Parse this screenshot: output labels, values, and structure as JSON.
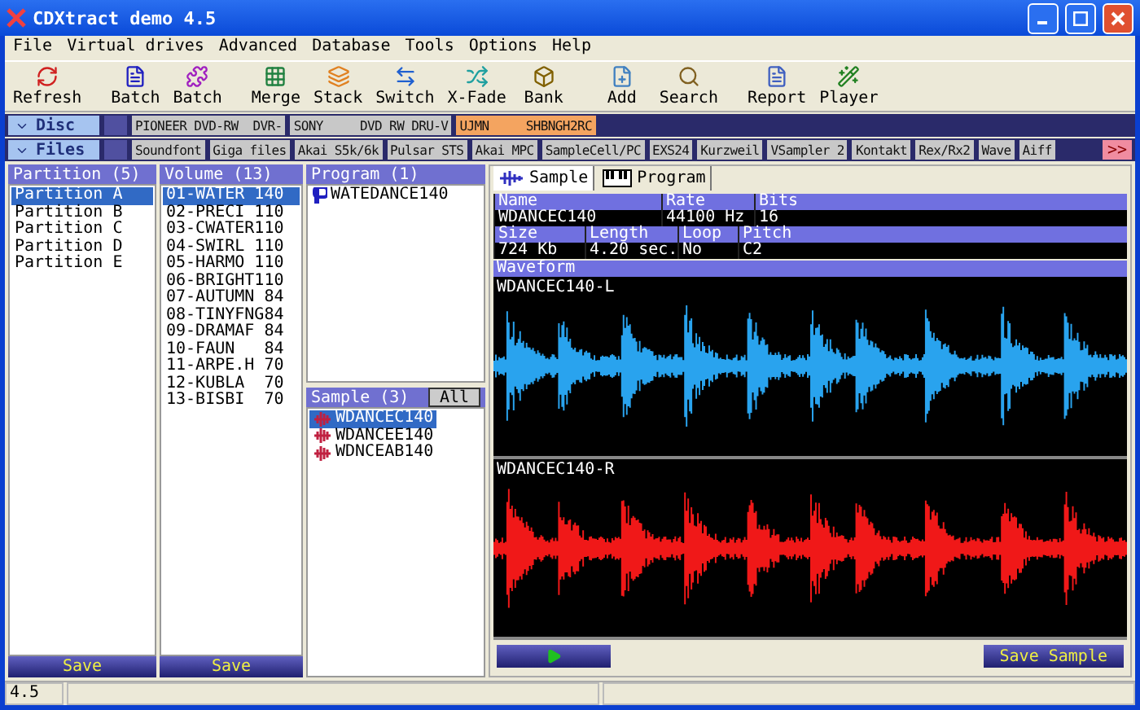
{
  "window": {
    "title": "CDXtract demo 4.5"
  },
  "menu": [
    "File",
    "Virtual drives",
    "Advanced",
    "Database",
    "Tools",
    "Options",
    "Help"
  ],
  "toolbar": [
    {
      "label": "Refresh"
    },
    {
      "label": "Batch"
    },
    {
      "label": "Batch"
    },
    {
      "label": "Merge"
    },
    {
      "label": "Stack"
    },
    {
      "label": "Switch"
    },
    {
      "label": "X-Fade"
    },
    {
      "label": "Bank"
    },
    {
      "label": "Add"
    },
    {
      "label": "Search"
    },
    {
      "label": "Report"
    },
    {
      "label": "Player"
    }
  ],
  "disc_bar": {
    "label": "Disc",
    "drives": [
      {
        "label": "PIONEER DVD-RW  DVR-",
        "selected": false
      },
      {
        "label": "SONY     DVD RW DRU-V",
        "selected": false
      },
      {
        "label": "UJMN     SHBNGH2RC",
        "selected": true
      }
    ]
  },
  "files_bar": {
    "label": "Files",
    "formats": [
      "Soundfont",
      "Giga files",
      "Akai S5k/6k",
      "Pulsar STS",
      "Akai MPC",
      "SampleCell/PC",
      "EXS24",
      "Kurzweil",
      "VSampler 2",
      "Kontakt",
      "Rex/Rx2",
      "Wave",
      "Aiff"
    ],
    "more": ">>"
  },
  "partitions": {
    "title": "Partition (5)",
    "items": [
      {
        "label": "Partition A",
        "selected": true
      },
      {
        "label": "Partition B",
        "selected": false
      },
      {
        "label": "Partition C",
        "selected": false
      },
      {
        "label": "Partition D",
        "selected": false
      },
      {
        "label": "Partition E",
        "selected": false
      }
    ],
    "save": "Save"
  },
  "volumes": {
    "title": "Volume (13)",
    "items": [
      {
        "label": "01-WATER 140",
        "selected": true
      },
      {
        "label": "02-PRECI 110",
        "selected": false
      },
      {
        "label": "03-CWATER110",
        "selected": false
      },
      {
        "label": "04-SWIRL 110",
        "selected": false
      },
      {
        "label": "05-HARMO 110",
        "selected": false
      },
      {
        "label": "06-BRIGHT110",
        "selected": false
      },
      {
        "label": "07-AUTUMN 84",
        "selected": false
      },
      {
        "label": "08-TINYFNG84",
        "selected": false
      },
      {
        "label": "09-DRAMAF 84",
        "selected": false
      },
      {
        "label": "10-FAUN   84",
        "selected": false
      },
      {
        "label": "11-ARPE.H 70",
        "selected": false
      },
      {
        "label": "12-KUBLA  70",
        "selected": false
      },
      {
        "label": "13-BISBI  70",
        "selected": false
      }
    ],
    "save": "Save"
  },
  "programs": {
    "title": "Program (1)",
    "items": [
      {
        "label": "WATEDANCE140"
      }
    ]
  },
  "samples": {
    "title": "Sample (3)",
    "all_button": "All",
    "items": [
      {
        "label": "WDANCEC140",
        "selected": true
      },
      {
        "label": "WDANCEE140",
        "selected": false
      },
      {
        "label": "WDNCEAB140",
        "selected": false
      }
    ]
  },
  "tabs": [
    {
      "label": "Sample",
      "selected": true
    },
    {
      "label": "Program",
      "selected": false
    }
  ],
  "info": [
    {
      "headers": [
        "Name",
        "Rate",
        "Bits"
      ],
      "values": [
        "WDANCEC140",
        "44100 Hz",
        "16"
      ]
    },
    {
      "headers": [
        "Size",
        "Length",
        "Loop",
        "Pitch"
      ],
      "values": [
        "724 Kb",
        "4.20 sec.",
        "No",
        "C2"
      ]
    }
  ],
  "waveform": {
    "title": "Waveform",
    "channels": [
      {
        "label": "WDANCEC140-L",
        "color": "#29a3ee"
      },
      {
        "label": "WDANCEC140-R",
        "color": "#f01818"
      }
    ]
  },
  "save_sample": "Save Sample",
  "status_bar": [
    "4.5"
  ]
}
